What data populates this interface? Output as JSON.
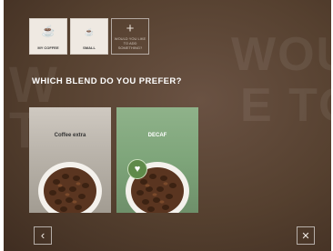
{
  "background_words": [
    "W",
    "WOUL",
    "T",
    "E TO"
  ],
  "steps": [
    {
      "label": "MY COFFEE",
      "icon": "coffee-cup-icon",
      "glyph": "☕"
    },
    {
      "label": "SMALL",
      "icon": "small-cup-icon",
      "glyph": "☕"
    },
    {
      "label": "WOULD YOU LIKE TO ADD SOMETHING?",
      "icon": "plus-icon",
      "glyph": "+"
    }
  ],
  "question": "WHICH BLEND DO YOU PREFER?",
  "blends": [
    {
      "name": "Coffee extra",
      "favorite": false
    },
    {
      "name": "DECAF",
      "favorite": true
    }
  ],
  "nav": {
    "back_glyph": "‹",
    "close_glyph": "✕"
  },
  "colors": {
    "accent_green": "#5f8a4a",
    "background_brown": "#55402f"
  }
}
